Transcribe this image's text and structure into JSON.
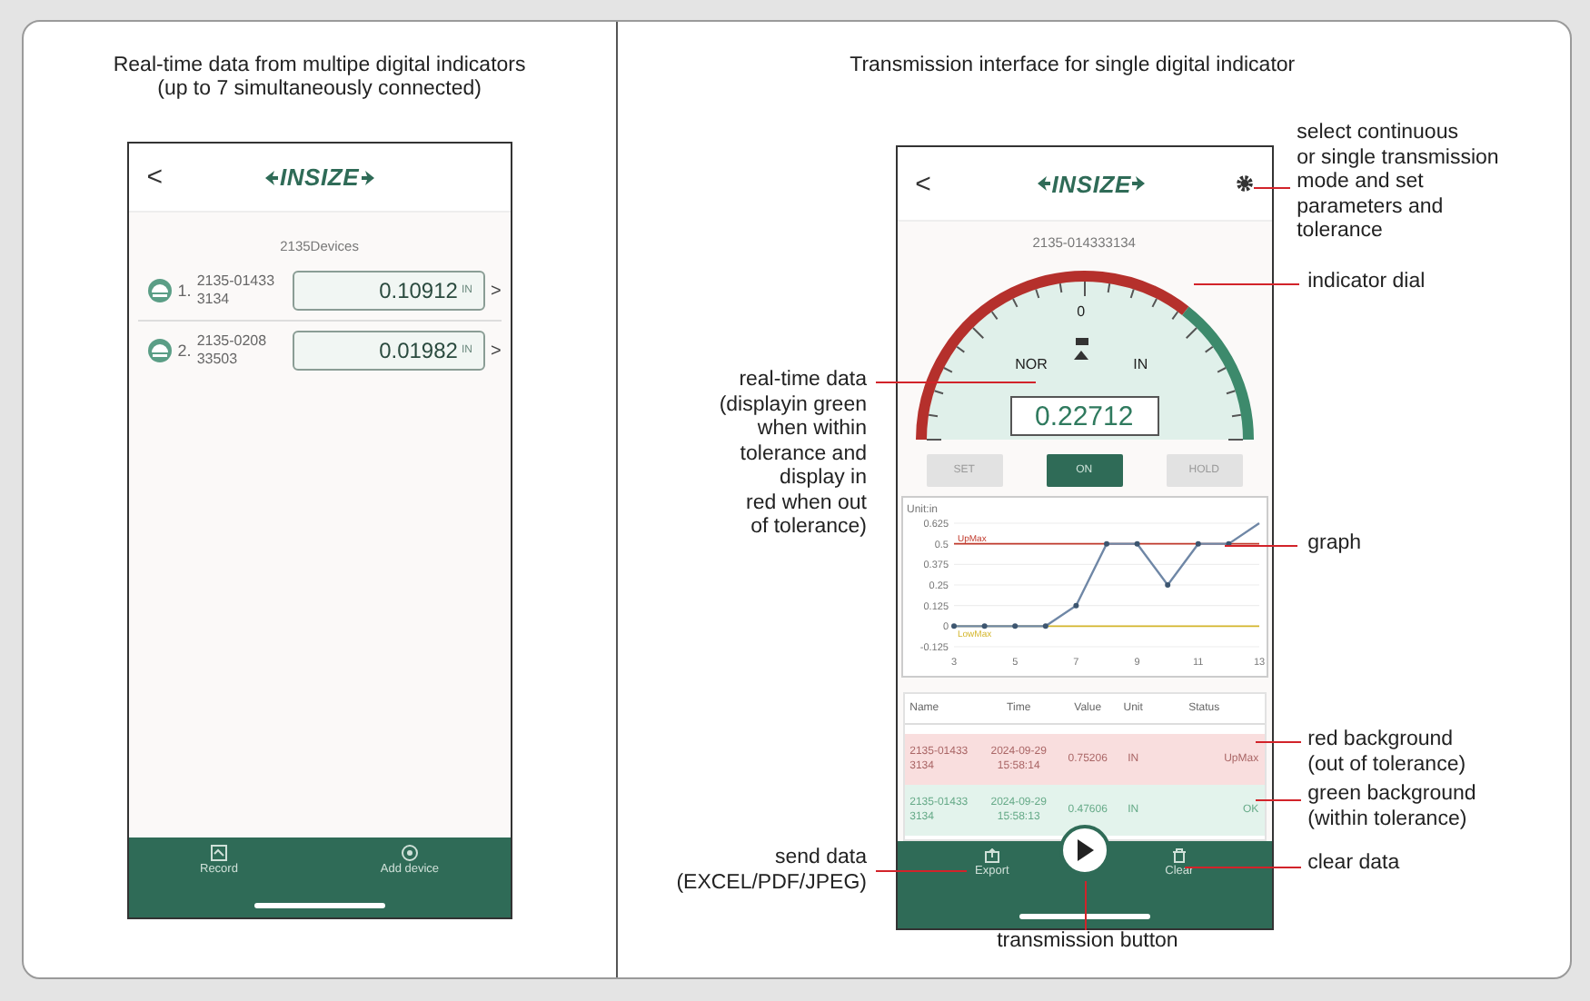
{
  "left_panel": {
    "caption": [
      "Real-time data from multipe digital indicators",
      "(up to 7 simultaneously connected)"
    ],
    "phone": {
      "back": "<",
      "logo": "INSIZE",
      "subtitle": "2135Devices",
      "devices": [
        {
          "index": "1.",
          "id_lines": [
            "2135-01433",
            "3134"
          ],
          "value": "0.10912",
          "unit": "IN",
          "arrow": ">"
        },
        {
          "index": "2.",
          "id_lines": [
            "2135-0208",
            "33503"
          ],
          "value": "0.01982",
          "unit": "IN",
          "arrow": ">"
        }
      ],
      "nav": [
        {
          "kind": "record",
          "label": "Record"
        },
        {
          "kind": "add",
          "label": "Add device"
        }
      ]
    }
  },
  "right_panel": {
    "caption": "Transmission interface for single digital indicator",
    "phone": {
      "back": "<",
      "logo": "INSIZE",
      "device_id": "2135-014333134",
      "dial": {
        "zero": "0",
        "mode": "NOR",
        "unit": "IN",
        "value": "0.22712",
        "in_tolerance": true
      },
      "buttons": [
        {
          "label": "SET",
          "selected": false
        },
        {
          "label": "ON",
          "selected": true
        },
        {
          "label": "HOLD",
          "selected": false
        }
      ],
      "chart": {
        "chart_data": {
          "type": "line",
          "ylabel": "Unit:in",
          "x": [
            3,
            4,
            5,
            6,
            7,
            8,
            9,
            10,
            11,
            12,
            13
          ],
          "grid": true,
          "series": [
            {
              "color": "#6f87a6",
              "marker": "o",
              "values": [
                0,
                0,
                0,
                0,
                0.125,
                0.5,
                0.5,
                0.25,
                0.5,
                0.5,
                0.625
              ]
            }
          ],
          "xlim": [
            3,
            13
          ],
          "ylim": [
            -0.125,
            0.625
          ],
          "xticks": [
            3,
            5,
            7,
            9,
            11,
            13
          ],
          "yticks": [
            {
              "value": 0.625,
              "label": "0.625"
            },
            {
              "value": 0.5,
              "label": "0.5"
            },
            {
              "value": 0.375,
              "label": "0.375"
            },
            {
              "value": 0.25,
              "label": "0.25"
            },
            {
              "value": 0.125,
              "label": "0.125"
            },
            {
              "value": 0,
              "label": "0"
            },
            {
              "value": -0.125,
              "label": "-0.125"
            }
          ],
          "ref_lines": [
            {
              "axis": "y",
              "value": 0.5,
              "label": "UpMax",
              "color": "#c0392b"
            },
            {
              "axis": "y",
              "value": 0,
              "label": "LowMax",
              "color": "#d4b62c"
            }
          ]
        }
      },
      "table": {
        "columns": [
          "Name",
          "Time",
          "Value",
          "Unit",
          "Status"
        ],
        "rows": [
          {
            "in_tolerance": false,
            "cells": [
              [
                "2135-01433",
                "3134"
              ],
              [
                "2024-09-29",
                "15:58:14"
              ],
              [
                "0.75206"
              ],
              [
                "IN"
              ],
              [
                "UpMax"
              ]
            ]
          },
          {
            "in_tolerance": true,
            "cells": [
              [
                "2135-01433",
                "3134"
              ],
              [
                "2024-09-29",
                "15:58:13"
              ],
              [
                "0.47606"
              ],
              [
                "IN"
              ],
              [
                "OK"
              ]
            ]
          }
        ]
      },
      "nav": [
        {
          "kind": "export",
          "label": "Export"
        },
        {
          "kind": "play"
        },
        {
          "kind": "clear",
          "label": "Clear"
        }
      ]
    },
    "annotations": [
      {
        "lines": [
          "select continuous",
          "or single transmission",
          "mode and set",
          "parameters and",
          "tolerance"
        ]
      },
      {
        "lines": [
          "indicator dial"
        ]
      },
      {
        "lines": [
          "real-time data",
          "(displayin green",
          "when within",
          "tolerance and",
          "display in",
          "red when out",
          "of tolerance)"
        ]
      },
      {
        "lines": [
          "graph"
        ]
      },
      {
        "lines": [
          "red background",
          "(out of tolerance)"
        ]
      },
      {
        "lines": [
          "green background",
          "(within tolerance)"
        ]
      },
      {
        "lines": [
          "clear data"
        ]
      },
      {
        "lines": [
          "send data",
          "(EXCEL/PDF/JPEG)"
        ]
      },
      {
        "lines": [
          "transmission button"
        ]
      }
    ]
  }
}
